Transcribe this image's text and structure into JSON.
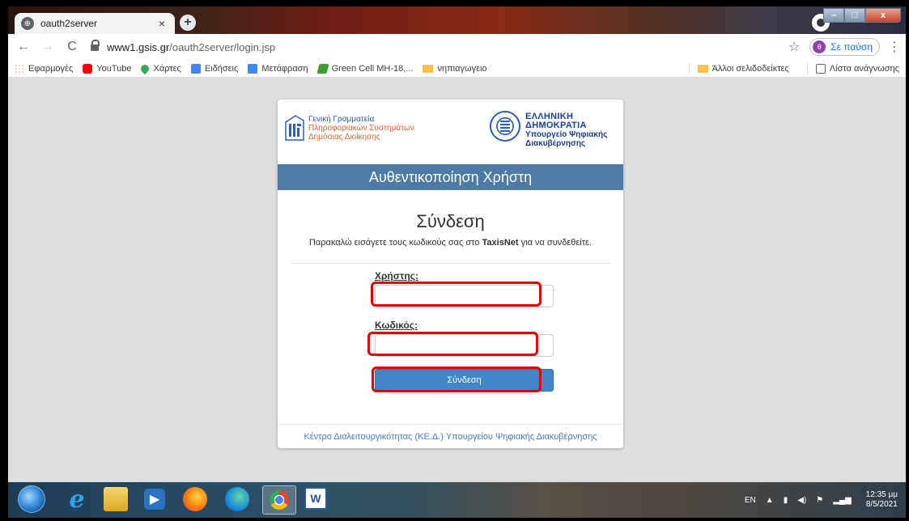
{
  "browser": {
    "tab_title": "oauth2server",
    "url_host": "www1.gsis.gr",
    "url_path": "/oauth2server/login.jsp",
    "profile_initial": "θ",
    "profile_status": "Σε παύση"
  },
  "bookmarks": {
    "items": [
      {
        "label": "Εφαρμογές",
        "icon": "apps-grid-icon"
      },
      {
        "label": "YouTube",
        "icon": "youtube-icon"
      },
      {
        "label": "Χάρτες",
        "icon": "maps-pin-icon"
      },
      {
        "label": "Ειδήσεις",
        "icon": "news-icon"
      },
      {
        "label": "Μετάφραση",
        "icon": "translate-icon"
      },
      {
        "label": "Green Cell MH-18,...",
        "icon": "greencell-icon"
      },
      {
        "label": "νηπιαγωγειο",
        "icon": "folder-icon"
      }
    ],
    "other": "Άλλοι σελιδοδείκτες",
    "reading_list": "Λίστα ανάγνωσης"
  },
  "login_page": {
    "gsis_line1": "Γενική Γραμματεία",
    "gsis_line2": "Πληροφοριακών Συστημάτων",
    "gsis_line3": "Δημόσιας Διοίκησης",
    "gov_line1": "ΕΛΛΗΝΙΚΗ ΔΗΜΟΚΡΑΤΙΑ",
    "gov_line2": "Υπουργείο Ψηφιακής",
    "gov_line3": "Διακυβέρνησης",
    "band_title": "Αυθεντικοποίηση Χρήστη",
    "title": "Σύνδεση",
    "desc_prefix": "Παρακαλώ εισάγετε τους κωδικούς σας στο ",
    "desc_bold": "TaxisNet",
    "desc_suffix": " για να συνδεθείτε.",
    "username_label": "Χρήστης:",
    "username_value": "",
    "password_label": "Κωδικός:",
    "password_value": "",
    "submit_label": "Σύνδεση",
    "footer": "Κέντρο Διαλειτουργικότητας (ΚΕ.Δ.) Υπουργείου Ψηφιακής Διακυβέρνησης"
  },
  "highlight_color": "#e00000",
  "taskbar": {
    "apps": [
      "start-orb",
      "internet-explorer-icon",
      "file-explorer-icon",
      "media-player-icon",
      "firefox-icon",
      "edge-icon",
      "chrome-icon",
      "word-icon"
    ],
    "lang": "EN",
    "time": "12:35 μμ",
    "date": "8/5/2021"
  }
}
